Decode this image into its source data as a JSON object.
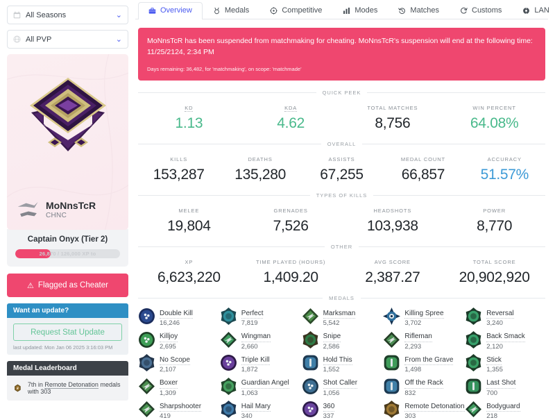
{
  "filters": [
    {
      "icon": "calendar-icon",
      "label": "All Seasons",
      "chevron": "⌄"
    },
    {
      "icon": "globe-icon",
      "label": "All PVP",
      "chevron": "⌄"
    }
  ],
  "player": {
    "name": "MoNnsTcR",
    "clan": "CHNC",
    "rank_title": "Captain Onyx (Tier 2)",
    "xp_text": "26,870 / 126,000 XP to",
    "xp_percent": 34,
    "flag_label": "Flagged as Cheater",
    "flag_icon": "warning-icon"
  },
  "update_panel": {
    "header": "Want an update?",
    "button_label": "Request Stat Update",
    "meta": "last updated: Mon Jan 06 2025 3:16:03 PM"
  },
  "medal_leaderboard": {
    "header": "Medal Leaderboard",
    "prefix": "7th in",
    "link": "Remote Detonation",
    "suffix": "medals with 303",
    "icon": "remote-detonation-icon"
  },
  "tabs": [
    {
      "label": "Overview",
      "icon": "briefcase-icon",
      "active": true
    },
    {
      "label": "Medals",
      "icon": "medal-icon",
      "active": false
    },
    {
      "label": "Competitive",
      "icon": "target-icon",
      "active": false
    },
    {
      "label": "Modes",
      "icon": "bars-icon",
      "active": false
    },
    {
      "label": "Matches",
      "icon": "history-icon",
      "active": false
    },
    {
      "label": "Customs",
      "icon": "refresh-icon",
      "active": false
    },
    {
      "label": "LAN",
      "icon": "globe-lan-icon",
      "active": false
    }
  ],
  "alert": {
    "message": "MoNnsTcR has been suspended from matchmaking for cheating. MoNnsTcR's suspension will end at the following time: 11/25/2124, 2:34 PM",
    "sub": "Days remaining: 36,482, for 'matchmaking', on scope: 'matchmade'"
  },
  "sections": [
    {
      "title": "QUICK PEEK",
      "stats": [
        {
          "label": "KD",
          "value": "1.13",
          "color": "green",
          "hinted": true
        },
        {
          "label": "KDA",
          "value": "4.62",
          "color": "green",
          "hinted": true
        },
        {
          "label": "TOTAL MATCHES",
          "value": "8,756",
          "color": "dark",
          "hinted": false
        },
        {
          "label": "WIN PERCENT",
          "value": "64.08%",
          "color": "green",
          "hinted": false
        }
      ]
    },
    {
      "title": "OVERALL",
      "stats": [
        {
          "label": "KILLS",
          "value": "153,287",
          "color": "dark",
          "hinted": false
        },
        {
          "label": "DEATHS",
          "value": "135,280",
          "color": "dark",
          "hinted": false
        },
        {
          "label": "ASSISTS",
          "value": "67,255",
          "color": "dark",
          "hinted": false
        },
        {
          "label": "MEDAL COUNT",
          "value": "66,857",
          "color": "dark",
          "hinted": false
        },
        {
          "label": "ACCURACY",
          "value": "51.57%",
          "color": "blue",
          "hinted": false
        }
      ]
    },
    {
      "title": "TYPES OF KILLS",
      "stats": [
        {
          "label": "MELEE",
          "value": "19,804",
          "color": "dark",
          "hinted": false
        },
        {
          "label": "GRENADES",
          "value": "7,526",
          "color": "dark",
          "hinted": false
        },
        {
          "label": "HEADSHOTS",
          "value": "103,938",
          "color": "dark",
          "hinted": false
        },
        {
          "label": "POWER",
          "value": "8,770",
          "color": "dark",
          "hinted": false
        }
      ]
    },
    {
      "title": "OTHER",
      "stats": [
        {
          "label": "XP",
          "value": "6,623,220",
          "color": "dark",
          "hinted": false
        },
        {
          "label": "TIME PLAYED (HOURS)",
          "value": "1,409.20",
          "color": "dark",
          "hinted": false
        },
        {
          "label": "AVG SCORE",
          "value": "2,387.27",
          "color": "dark",
          "hinted": false
        },
        {
          "label": "TOTAL SCORE",
          "value": "20,902,920",
          "color": "dark",
          "hinted": false
        }
      ]
    }
  ],
  "medals_title": "MEDALS",
  "medals": [
    {
      "name": "Double Kill",
      "count": "16,246",
      "c1": "#1b2d5e",
      "c2": "#2b4a8f",
      "shape": "circle"
    },
    {
      "name": "Perfect",
      "count": "7,819",
      "c1": "#1d4a52",
      "c2": "#2f8f9c",
      "shape": "gear"
    },
    {
      "name": "Marksman",
      "count": "5,542",
      "c1": "#2b4a2a",
      "c2": "#4e8f4a",
      "shape": "diamond"
    },
    {
      "name": "Killing Spree",
      "count": "3,702",
      "c1": "#14314f",
      "c2": "#2f6f9c",
      "shape": "star"
    },
    {
      "name": "Reversal",
      "count": "3,240",
      "c1": "#1c3b2a",
      "c2": "#38a06a",
      "shape": "gear"
    },
    {
      "name": "Killjoy",
      "count": "2,695",
      "c1": "#1d3f26",
      "c2": "#3e9e56",
      "shape": "circle"
    },
    {
      "name": "Wingman",
      "count": "2,660",
      "c1": "#213f2c",
      "c2": "#3f9c60",
      "shape": "diamond"
    },
    {
      "name": "Snipe",
      "count": "2,586",
      "c1": "#3a3420",
      "c2": "#2f7a46",
      "shape": "gear"
    },
    {
      "name": "Rifleman",
      "count": "2,293",
      "c1": "#243d26",
      "c2": "#4b8c52",
      "shape": "diamond"
    },
    {
      "name": "Back Smack",
      "count": "2,120",
      "c1": "#1c3a28",
      "c2": "#36a06a",
      "shape": "gear"
    },
    {
      "name": "No Scope",
      "count": "2,107",
      "c1": "#23354a",
      "c2": "#4a6f93",
      "shape": "gear"
    },
    {
      "name": "Triple Kill",
      "count": "1,872",
      "c1": "#2e1a47",
      "c2": "#6a3f9c",
      "shape": "circle"
    },
    {
      "name": "Hold This",
      "count": "1,552",
      "c1": "#1e3a52",
      "c2": "#3f7fa8",
      "shape": "squircle"
    },
    {
      "name": "From the Grave",
      "count": "1,498",
      "c1": "#1e3f2a",
      "c2": "#3f9c5a",
      "shape": "squircle"
    },
    {
      "name": "Stick",
      "count": "1,355",
      "c1": "#1d3c28",
      "c2": "#39a065",
      "shape": "gear"
    },
    {
      "name": "Boxer",
      "count": "1,309",
      "c1": "#243f28",
      "c2": "#4d9050",
      "shape": "diamond"
    },
    {
      "name": "Guardian Angel",
      "count": "1,063",
      "c1": "#22462c",
      "c2": "#45a05f",
      "shape": "gear"
    },
    {
      "name": "Shot Caller",
      "count": "1,056",
      "c1": "#1c3549",
      "c2": "#3e6f93",
      "shape": "circle"
    },
    {
      "name": "Off the Rack",
      "count": "832",
      "c1": "#1d3a52",
      "c2": "#4080a8",
      "shape": "squircle"
    },
    {
      "name": "Last Shot",
      "count": "700",
      "c1": "#1d3a28",
      "c2": "#35925c",
      "shape": "squircle"
    },
    {
      "name": "Sharpshooter",
      "count": "419",
      "c1": "#24402a",
      "c2": "#4b9452",
      "shape": "diamond"
    },
    {
      "name": "Hail Mary",
      "count": "340",
      "c1": "#1d3650",
      "c2": "#3f7aa8",
      "shape": "gear"
    },
    {
      "name": "360",
      "count": "337",
      "c1": "#2d1c4a",
      "c2": "#6b45a0",
      "shape": "circle"
    },
    {
      "name": "Remote Detonation",
      "count": "303",
      "c1": "#4a3a1c",
      "c2": "#a07a35",
      "shape": "gear"
    },
    {
      "name": "Bodyguard",
      "count": "218",
      "c1": "#1e3f2a",
      "c2": "#3f9c5f",
      "shape": "diamond"
    }
  ]
}
